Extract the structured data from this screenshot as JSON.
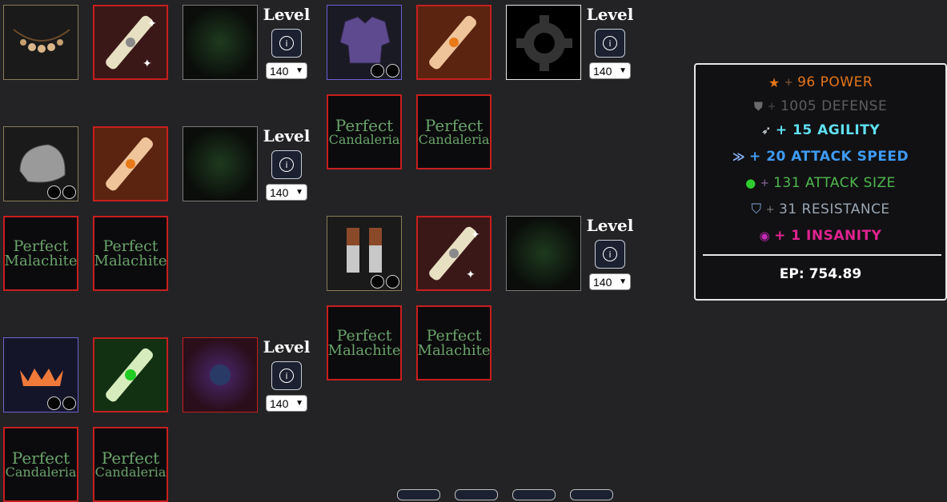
{
  "level_label": "Level",
  "level_options": [
    "140"
  ],
  "gems": {
    "perfect": "Perfect",
    "candaleria": "Candaleria",
    "malachite": "Malachite"
  },
  "stats": [
    {
      "name": "power",
      "plus": "+",
      "text": "96 POWER",
      "color": "#e6761a"
    },
    {
      "name": "defense",
      "plus": "+",
      "text": "1005 DEFENSE",
      "color": "#5d5d5d"
    },
    {
      "name": "agility",
      "plus": "+",
      "text": "+ 15 AGILITY",
      "color": "#5fe0f0"
    },
    {
      "name": "attack-speed",
      "plus": "+",
      "text": "+ 20 ATTACK SPEED",
      "color": "#3e9bf5"
    },
    {
      "name": "attack-size",
      "plus": "+",
      "text": "131 ATTACK SIZE",
      "color": "#4fb84f"
    },
    {
      "name": "resistance",
      "plus": "+",
      "text": "31 RESISTANCE",
      "color": "#9aa6b2"
    },
    {
      "name": "insanity",
      "plus": "+",
      "text": "+ 1 INSANITY",
      "color": "#e0238f"
    }
  ],
  "ep": "EP: 754.89"
}
